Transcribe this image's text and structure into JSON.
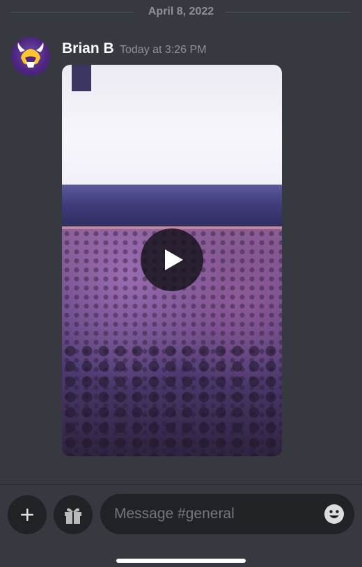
{
  "chat": {
    "date_divider": "April 8, 2022",
    "message": {
      "author": "Brian B",
      "timestamp": "Today at 3:26 PM",
      "avatar_icon": "vikings-helmet-icon",
      "attachment": {
        "type": "video",
        "play_icon": "play-icon"
      }
    }
  },
  "composer": {
    "add_icon": "plus-icon",
    "gift_icon": "gift-icon",
    "placeholder": "Message #general",
    "emoji_icon": "smiley-emoji-icon"
  },
  "colors": {
    "background": "#36393f",
    "input_background": "#202225",
    "author": "#ffffff",
    "muted_text": "#8e9297"
  }
}
